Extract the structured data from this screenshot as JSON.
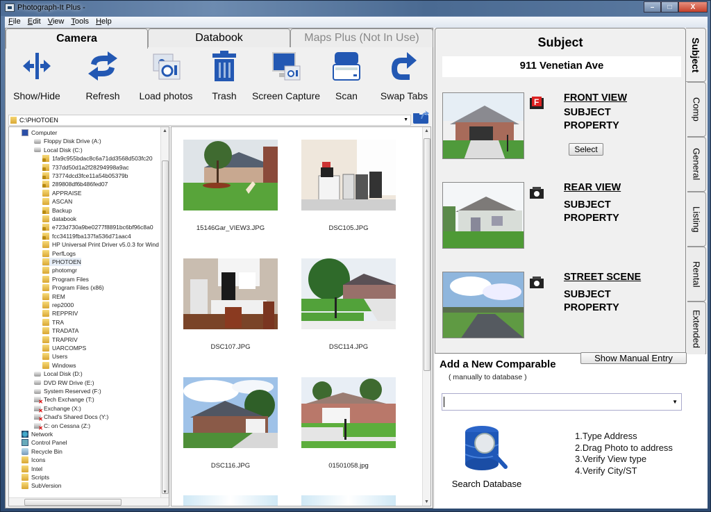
{
  "window": {
    "title": "Photograph-It Plus -",
    "controls": {
      "minimize": "–",
      "maximize": "□",
      "close": "X"
    }
  },
  "menu": [
    {
      "label": "File",
      "accel": "F",
      "rest": "ile"
    },
    {
      "label": "Edit",
      "accel": "E",
      "rest": "dit"
    },
    {
      "label": "View",
      "accel": "V",
      "rest": "iew"
    },
    {
      "label": "Tools",
      "accel": "T",
      "rest": "ools"
    },
    {
      "label": "Help",
      "accel": "H",
      "rest": "elp"
    }
  ],
  "main_tabs": [
    {
      "label": "Camera",
      "state": "active"
    },
    {
      "label": "Databook",
      "state": "normal"
    },
    {
      "label": "Maps Plus (Not In Use)",
      "state": "disabled"
    }
  ],
  "toolbar": [
    {
      "label": "Show/Hide",
      "icon": "split-arrows-icon"
    },
    {
      "label": "Refresh",
      "icon": "refresh-icon"
    },
    {
      "label": "Load photos",
      "icon": "load-photos-icon"
    },
    {
      "label": "Trash",
      "icon": "trash-icon"
    },
    {
      "label": "Screen Capture",
      "icon": "screen-capture-icon"
    },
    {
      "label": "Scan",
      "icon": "scanner-icon"
    },
    {
      "label": "Swap Tabs",
      "icon": "swap-arrow-icon"
    }
  ],
  "path": {
    "value": "C:\\PHOTOEN"
  },
  "tree": [
    {
      "label": "Computer",
      "level": 0,
      "type": "computer"
    },
    {
      "label": "Floppy Disk Drive (A:)",
      "level": 1,
      "type": "drive"
    },
    {
      "label": "Local Disk (C:)",
      "level": 1,
      "type": "drive"
    },
    {
      "label": "1fa9c955bdac8c6a71dd3568d503fc20",
      "level": 2,
      "type": "lockfolder"
    },
    {
      "label": "737dd50d1a2f28294998a9ac",
      "level": 2,
      "type": "lockfolder"
    },
    {
      "label": "73774dcd3fce11a54b05379b",
      "level": 2,
      "type": "lockfolder"
    },
    {
      "label": "289808df6b486fed07",
      "level": 2,
      "type": "lockfolder"
    },
    {
      "label": "APPRAISE",
      "level": 2,
      "type": "folder"
    },
    {
      "label": "ASCAN",
      "level": 2,
      "type": "folder"
    },
    {
      "label": "Backup",
      "level": 2,
      "type": "lockfolder"
    },
    {
      "label": "databook",
      "level": 2,
      "type": "folder"
    },
    {
      "label": "e723d730a9be0277f8891bc6bf96c8a0",
      "level": 2,
      "type": "lockfolder"
    },
    {
      "label": "fcc34119fba137fa536d71aac4",
      "level": 2,
      "type": "lockfolder"
    },
    {
      "label": "HP Universal Print Driver v5.0.3 for Wind",
      "level": 2,
      "type": "folder"
    },
    {
      "label": "PerfLogs",
      "level": 2,
      "type": "folder"
    },
    {
      "label": "PHOTOEN",
      "level": 2,
      "type": "folder",
      "selected": true
    },
    {
      "label": "photomgr",
      "level": 2,
      "type": "folder"
    },
    {
      "label": "Program Files",
      "level": 2,
      "type": "folder"
    },
    {
      "label": "Program Files (x86)",
      "level": 2,
      "type": "folder"
    },
    {
      "label": "REM",
      "level": 2,
      "type": "folder"
    },
    {
      "label": "rep2000",
      "level": 2,
      "type": "folder"
    },
    {
      "label": "REPPRIV",
      "level": 2,
      "type": "folder"
    },
    {
      "label": "TRA",
      "level": 2,
      "type": "folder"
    },
    {
      "label": "TRADATA",
      "level": 2,
      "type": "folder"
    },
    {
      "label": "TRAPRIV",
      "level": 2,
      "type": "folder"
    },
    {
      "label": "UARCOMPS",
      "level": 2,
      "type": "folder"
    },
    {
      "label": "Users",
      "level": 2,
      "type": "folder"
    },
    {
      "label": "Windows",
      "level": 2,
      "type": "folder"
    },
    {
      "label": "Local Disk (D:)",
      "level": 1,
      "type": "drive"
    },
    {
      "label": "DVD RW Drive (E:)",
      "level": 1,
      "type": "drive"
    },
    {
      "label": "System Reserved (F:)",
      "level": 1,
      "type": "drive"
    },
    {
      "label": "Tech Exchange (T:)",
      "level": 1,
      "type": "netdrive"
    },
    {
      "label": "Exchange (X:)",
      "level": 1,
      "type": "netdrive"
    },
    {
      "label": "Chad's Shared Docs (Y:)",
      "level": 1,
      "type": "netdrive"
    },
    {
      "label": "C: on Cessna (Z:)",
      "level": 1,
      "type": "netdrive"
    },
    {
      "label": "Network",
      "level": 0,
      "type": "network"
    },
    {
      "label": "Control Panel",
      "level": 0,
      "type": "cpanel"
    },
    {
      "label": "Recycle Bin",
      "level": 0,
      "type": "recycle"
    },
    {
      "label": "Icons",
      "level": 0,
      "type": "folder"
    },
    {
      "label": "Intel",
      "level": 0,
      "type": "folder"
    },
    {
      "label": "Scripts",
      "level": 0,
      "type": "folder"
    },
    {
      "label": "SubVersion",
      "level": 0,
      "type": "folder"
    }
  ],
  "photos": [
    {
      "filename": "15146Gar_VIEW3.JPG",
      "scene": "house-tree"
    },
    {
      "filename": "DSC105.JPG",
      "scene": "garage-interior"
    },
    {
      "filename": "DSC107.JPG",
      "scene": "kitchen"
    },
    {
      "filename": "DSC114.JPG",
      "scene": "street-yard"
    },
    {
      "filename": "DSC116.JPG",
      "scene": "house-sky"
    },
    {
      "filename": "01501058.jpg",
      "scene": "house-front"
    }
  ],
  "subject": {
    "title": "Subject",
    "address": "911 Venetian Ave",
    "views": [
      {
        "title": "FRONT VIEW",
        "line1": "SUBJECT",
        "line2": "PROPERTY",
        "icon": "front-view-flag-icon",
        "has_select": true
      },
      {
        "title": "REAR VIEW",
        "line1": "SUBJECT",
        "line2": "PROPERTY",
        "icon": "camera-icon",
        "has_select": false
      },
      {
        "title": "STREET SCENE",
        "line1": "SUBJECT",
        "line2": "PROPERTY",
        "icon": "camera-icon",
        "has_select": false
      }
    ],
    "select_label": "Select"
  },
  "side_tabs": [
    {
      "label": "Subject",
      "state": "active"
    },
    {
      "label": "Comp",
      "state": "normal"
    },
    {
      "label": "General",
      "state": "normal"
    },
    {
      "label": "Listing",
      "state": "normal"
    },
    {
      "label": "Rental",
      "state": "normal"
    },
    {
      "label": "Extended",
      "state": "normal"
    }
  ],
  "manual_entry_label": "Show Manual Entry",
  "add_comparable": {
    "title": "Add a New Comparable",
    "subtitle": "( manually to database )",
    "address_value": "",
    "search_label": "Search Database",
    "steps": [
      "1.Type Address",
      "2.Drag Photo to address",
      "3.Verify View type",
      "4.Verify City/ST"
    ]
  }
}
